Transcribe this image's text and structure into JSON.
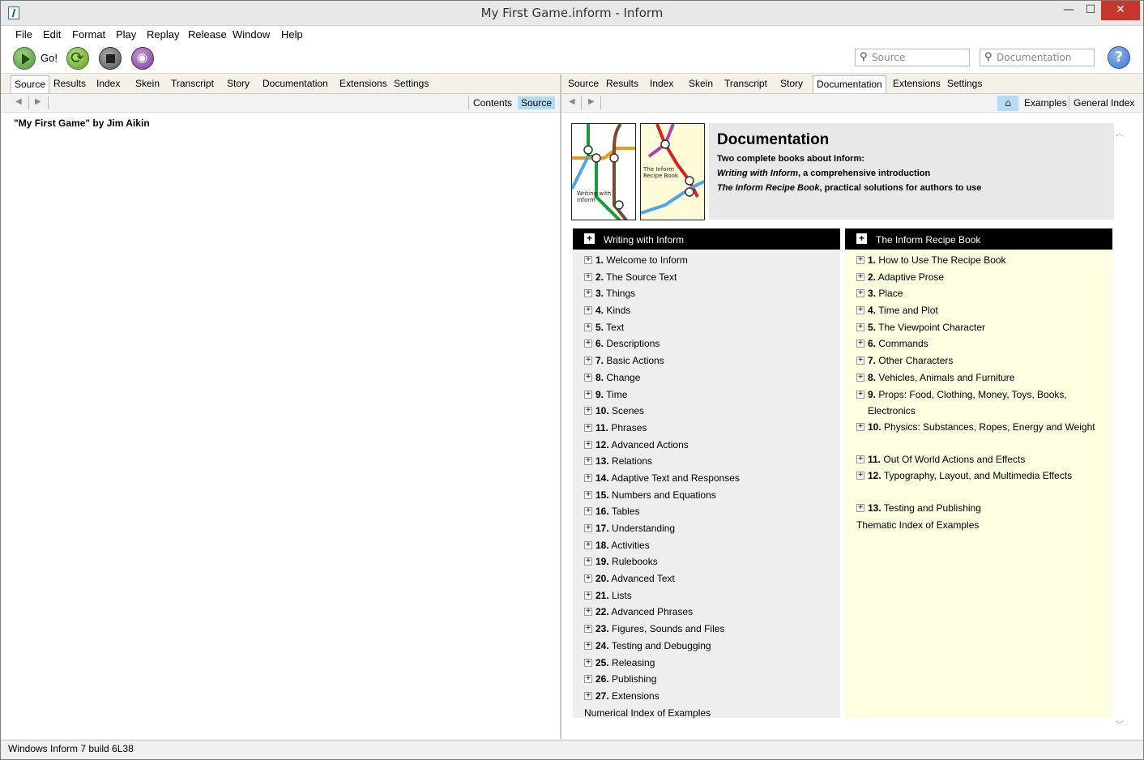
{
  "window": {
    "title": "My First Game.inform - Inform"
  },
  "menu": [
    "File",
    "Edit",
    "Format",
    "Play",
    "Replay",
    "Release",
    "Window",
    "Help"
  ],
  "toolbar": {
    "go_label": "Go!",
    "source_placeholder": "Source",
    "documentation_placeholder": "Documentation",
    "help_symbol": "?"
  },
  "left_panel": {
    "tabs": [
      "Source",
      "Results",
      "Index",
      "Skein",
      "Transcript",
      "Story",
      "Documentation",
      "Extensions",
      "Settings"
    ],
    "subtabs": [
      "Contents",
      "Source"
    ],
    "source_text": "\"My First Game\" by Jim Aikin"
  },
  "right_panel": {
    "tabs": [
      "Source",
      "Results",
      "Index",
      "Skein",
      "Transcript",
      "Story",
      "Documentation",
      "Extensions",
      "Settings"
    ],
    "subtabs": [
      "Examples",
      "General Index"
    ],
    "doc_title": "Documentation",
    "doc_intro": "Two complete books about Inform:",
    "book1_title": "Writing with Inform",
    "book1_desc": ", a comprehensive introduction",
    "book2_title": "The Inform Recipe Book",
    "book2_desc": ", practical solutions for authors to use",
    "cover1_label": "Writing with Inform",
    "cover2_label": "The Inform Recipe Book"
  },
  "writing": {
    "header": "Writing with Inform",
    "chapters": [
      {
        "n": "1.",
        "t": "Welcome to Inform"
      },
      {
        "n": "2.",
        "t": "The Source Text"
      },
      {
        "n": "3.",
        "t": "Things"
      },
      {
        "n": "4.",
        "t": "Kinds"
      },
      {
        "n": "5.",
        "t": "Text"
      },
      {
        "n": "6.",
        "t": "Descriptions"
      },
      {
        "n": "7.",
        "t": "Basic Actions"
      },
      {
        "n": "8.",
        "t": "Change"
      },
      {
        "n": "9.",
        "t": "Time"
      },
      {
        "n": "10.",
        "t": "Scenes"
      },
      {
        "n": "11.",
        "t": "Phrases"
      },
      {
        "n": "12.",
        "t": "Advanced Actions"
      },
      {
        "n": "13.",
        "t": "Relations"
      },
      {
        "n": "14.",
        "t": "Adaptive Text and Responses"
      },
      {
        "n": "15.",
        "t": "Numbers and Equations"
      },
      {
        "n": "16.",
        "t": "Tables"
      },
      {
        "n": "17.",
        "t": "Understanding"
      },
      {
        "n": "18.",
        "t": "Activities"
      },
      {
        "n": "19.",
        "t": "Rulebooks"
      },
      {
        "n": "20.",
        "t": "Advanced Text"
      },
      {
        "n": "21.",
        "t": "Lists"
      },
      {
        "n": "22.",
        "t": "Advanced Phrases"
      },
      {
        "n": "23.",
        "t": "Figures, Sounds and Files"
      },
      {
        "n": "24.",
        "t": "Testing and Debugging"
      },
      {
        "n": "25.",
        "t": "Releasing"
      },
      {
        "n": "26.",
        "t": "Publishing"
      },
      {
        "n": "27.",
        "t": "Extensions"
      }
    ],
    "index_link": "Numerical Index of Examples"
  },
  "recipe": {
    "header": "The Inform Recipe Book",
    "chapters": [
      {
        "n": "1.",
        "t": "How to Use The Recipe Book"
      },
      {
        "n": "2.",
        "t": "Adaptive Prose"
      },
      {
        "n": "3.",
        "t": "Place"
      },
      {
        "n": "4.",
        "t": "Time and Plot"
      },
      {
        "n": "5.",
        "t": "The Viewpoint Character"
      },
      {
        "n": "6.",
        "t": "Commands"
      },
      {
        "n": "7.",
        "t": "Other Characters"
      },
      {
        "n": "8.",
        "t": "Vehicles, Animals and Furniture"
      },
      {
        "n": "9.",
        "t": "Props: Food, Clothing, Money, Toys, Books, Electronics"
      },
      {
        "n": "10.",
        "t": "Physics: Substances, Ropes, Energy and Weight"
      },
      {
        "n": "11.",
        "t": "Out Of World Actions and Effects"
      },
      {
        "n": "12.",
        "t": "Typography, Layout, and Multimedia Effects"
      },
      {
        "n": "13.",
        "t": "Testing and Publishing"
      }
    ],
    "index_link": "Thematic Index of Examples"
  },
  "status": {
    "text": "Windows Inform 7 build 6L38"
  }
}
